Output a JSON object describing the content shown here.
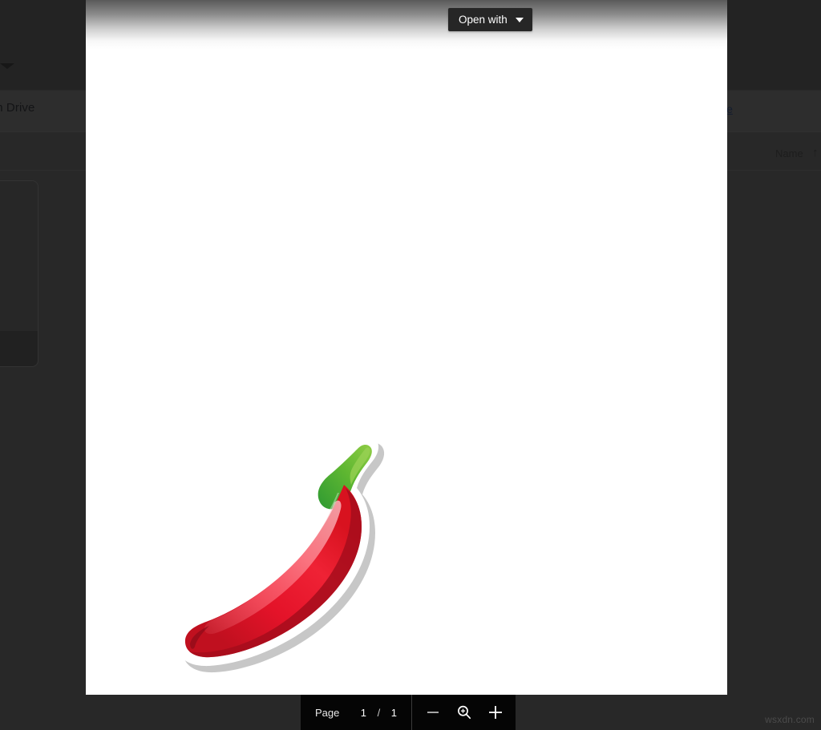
{
  "background": {
    "banner_text": "k people in Drive",
    "banner_link": "more",
    "column_header_name": "Name",
    "sort_arrow": "↑"
  },
  "viewer": {
    "open_with": {
      "label": "Open with",
      "caret_icon": "chevron-down-icon"
    },
    "document": {
      "illustration": "red-chili-pepper-sticker",
      "colors": {
        "pepper_light": "#ef1b2e",
        "pepper_mid": "#e01029",
        "pepper_dark": "#b50f22",
        "pepper_highlight": "#f4455a",
        "stem_light": "#8cc63f",
        "stem_dark": "#3aa536",
        "outline": "#ffffff",
        "shadow": "rgba(0,0,0,0.18)"
      }
    }
  },
  "toolbar": {
    "page_label": "Page",
    "page_current": "1",
    "page_separator": "/",
    "page_total": "1",
    "zoom_out_icon": "minus-icon",
    "fit_icon": "magnifier-plus-icon",
    "zoom_in_icon": "plus-icon"
  },
  "watermark": {
    "text": "wsxdn.com"
  }
}
